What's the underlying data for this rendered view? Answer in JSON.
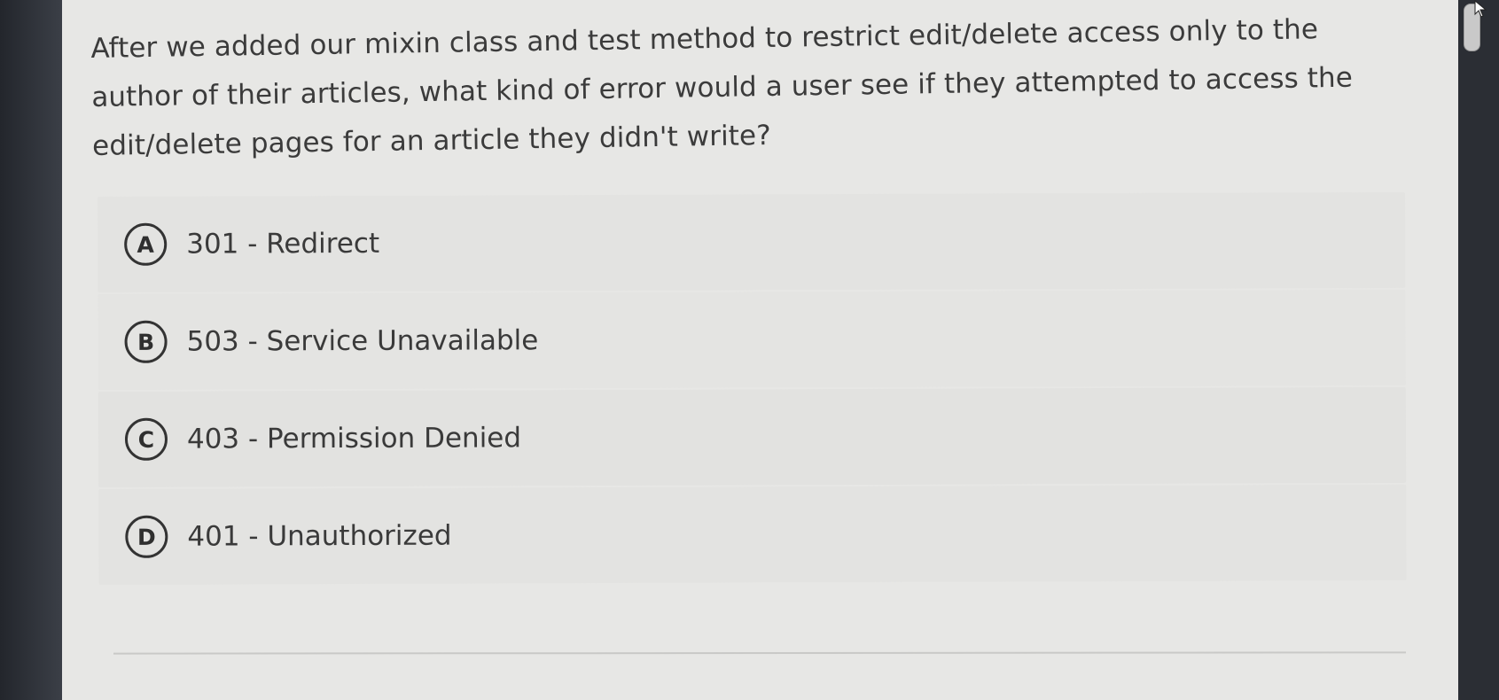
{
  "question": {
    "text": "After we added our mixin class and test method to restrict edit/delete access only to the author of their articles, what kind of error would a user see if they attempted to access the edit/delete pages for an article they didn't write?"
  },
  "options": [
    {
      "letter": "A",
      "text": "301 - Redirect"
    },
    {
      "letter": "B",
      "text": "503 - Service Unavailable"
    },
    {
      "letter": "C",
      "text": "403 - Permission Denied"
    },
    {
      "letter": "D",
      "text": "401 - Unauthorized"
    }
  ],
  "colors": {
    "background": "#e7e7e5",
    "text": "#3b3b3b",
    "letter_border": "#333333"
  }
}
